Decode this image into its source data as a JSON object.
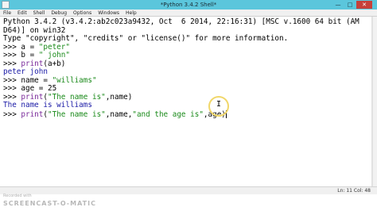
{
  "window": {
    "title": "*Python 3.4.2 Shell*"
  },
  "menu": [
    "File",
    "Edit",
    "Shell",
    "Debug",
    "Options",
    "Windows",
    "Help"
  ],
  "shell": {
    "banner1": "Python 3.4.2 (v3.4.2:ab2c023a9432, Oct  6 2014, 22:16:31) [MSC v.1600 64 bit (AM",
    "banner2": "D64)] on win32",
    "banner3": "Type \"copyright\", \"credits\" or \"license()\" for more information.",
    "prompt": ">>> ",
    "l4_code": "a = ",
    "l4_str": "\"peter\"",
    "l5_code": "b = ",
    "l5_str": "\" john\"",
    "l6_kw": "print",
    "l6_code": "(a+b)",
    "out1": "peter john",
    "l8_code": "name = ",
    "l8_str": "\"williams\"",
    "l9_code": "age = 25",
    "l10_kw": "print",
    "l10_a": "(",
    "l10_str": "\"The name is\"",
    "l10_b": ",name)",
    "out2": "The name is williams",
    "l12_kw": "print",
    "l12_a": "(",
    "l12_str1": "\"The name is\"",
    "l12_b": ",name,",
    "l12_str2": "\"and the age is\"",
    "l12_c": ",age)"
  },
  "status": {
    "position": "Ln: 11  Col: 48"
  },
  "watermark": {
    "recorded_with": "Recorded with",
    "brand": "SCREENCAST-O-MATIC"
  },
  "colors": {
    "titlebar": "#5bc6dc",
    "output": "#1a1aa6",
    "string": "#1a8a1a",
    "keyword": "#7a2a9a",
    "highlight_ring": "#f1d76a"
  }
}
